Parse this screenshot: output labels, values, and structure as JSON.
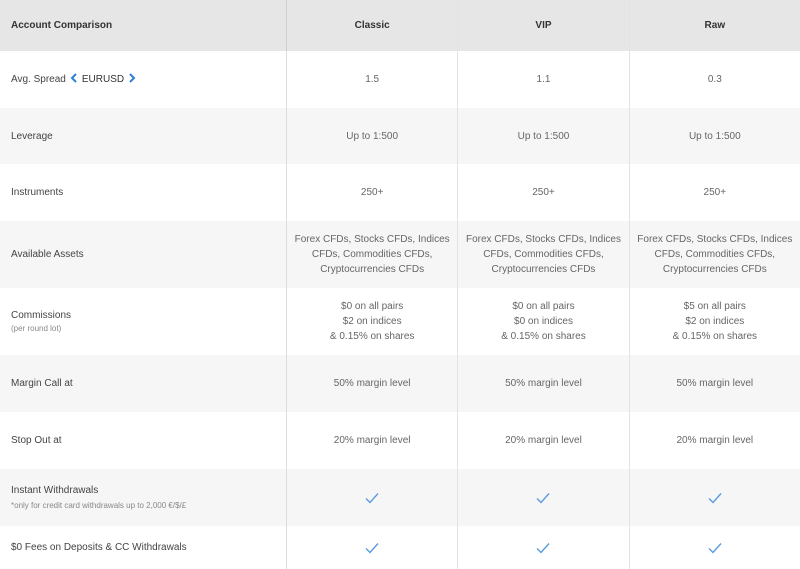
{
  "header": {
    "title": "Account Comparison",
    "plans": [
      "Classic",
      "VIP",
      "Raw"
    ]
  },
  "rows": [
    {
      "label": "Avg. Spread",
      "selector": {
        "prev_icon": "chevron-left-icon",
        "value": "EURUSD",
        "next_icon": "chevron-right-icon"
      },
      "values": [
        "1.5",
        "1.1",
        "0.3"
      ]
    },
    {
      "label": "Leverage",
      "values": [
        "Up to 1:500",
        "Up to 1:500",
        "Up to 1:500"
      ]
    },
    {
      "label": "Instruments",
      "values": [
        "250+",
        "250+",
        "250+"
      ]
    },
    {
      "label": "Available Assets",
      "values": [
        "Forex CFDs, Stocks CFDs, Indices\nCFDs, Commodities CFDs,\nCryptocurrencies CFDs",
        "Forex CFDs, Stocks CFDs, Indices\nCFDs, Commodities CFDs,\nCryptocurrencies CFDs",
        "Forex CFDs, Stocks CFDs, Indices\nCFDs, Commodities CFDs,\nCryptocurrencies CFDs"
      ]
    },
    {
      "label": "Commissions",
      "sublabel": "(per round lot)",
      "values": [
        "$0 on all pairs\n$2 on indices\n& 0.15% on shares",
        "$0 on all pairs\n$0 on indices\n& 0.15% on shares",
        "$5 on all pairs\n$2 on indices\n& 0.15% on shares"
      ]
    },
    {
      "label": "Margin Call at",
      "values": [
        "50% margin level",
        "50% margin level",
        "50% margin level"
      ]
    },
    {
      "label": "Stop Out at",
      "values": [
        "20% margin level",
        "20% margin level",
        "20% margin level"
      ]
    },
    {
      "label": "Instant Withdrawals",
      "sublabel": "*only for credit card withdrawals up to 2,000 €/$/£",
      "values": [
        "check-icon",
        "check-icon",
        "check-icon"
      ]
    },
    {
      "label": "$0 Fees on Deposits & CC Withdrawals",
      "values": [
        "check-icon",
        "check-icon",
        "check-icon"
      ]
    }
  ],
  "colors": {
    "accent": "#2f7fd8",
    "check": "#5b9be0",
    "header_bg": "#e6e6e6",
    "shade_bg": "#f6f6f6"
  }
}
